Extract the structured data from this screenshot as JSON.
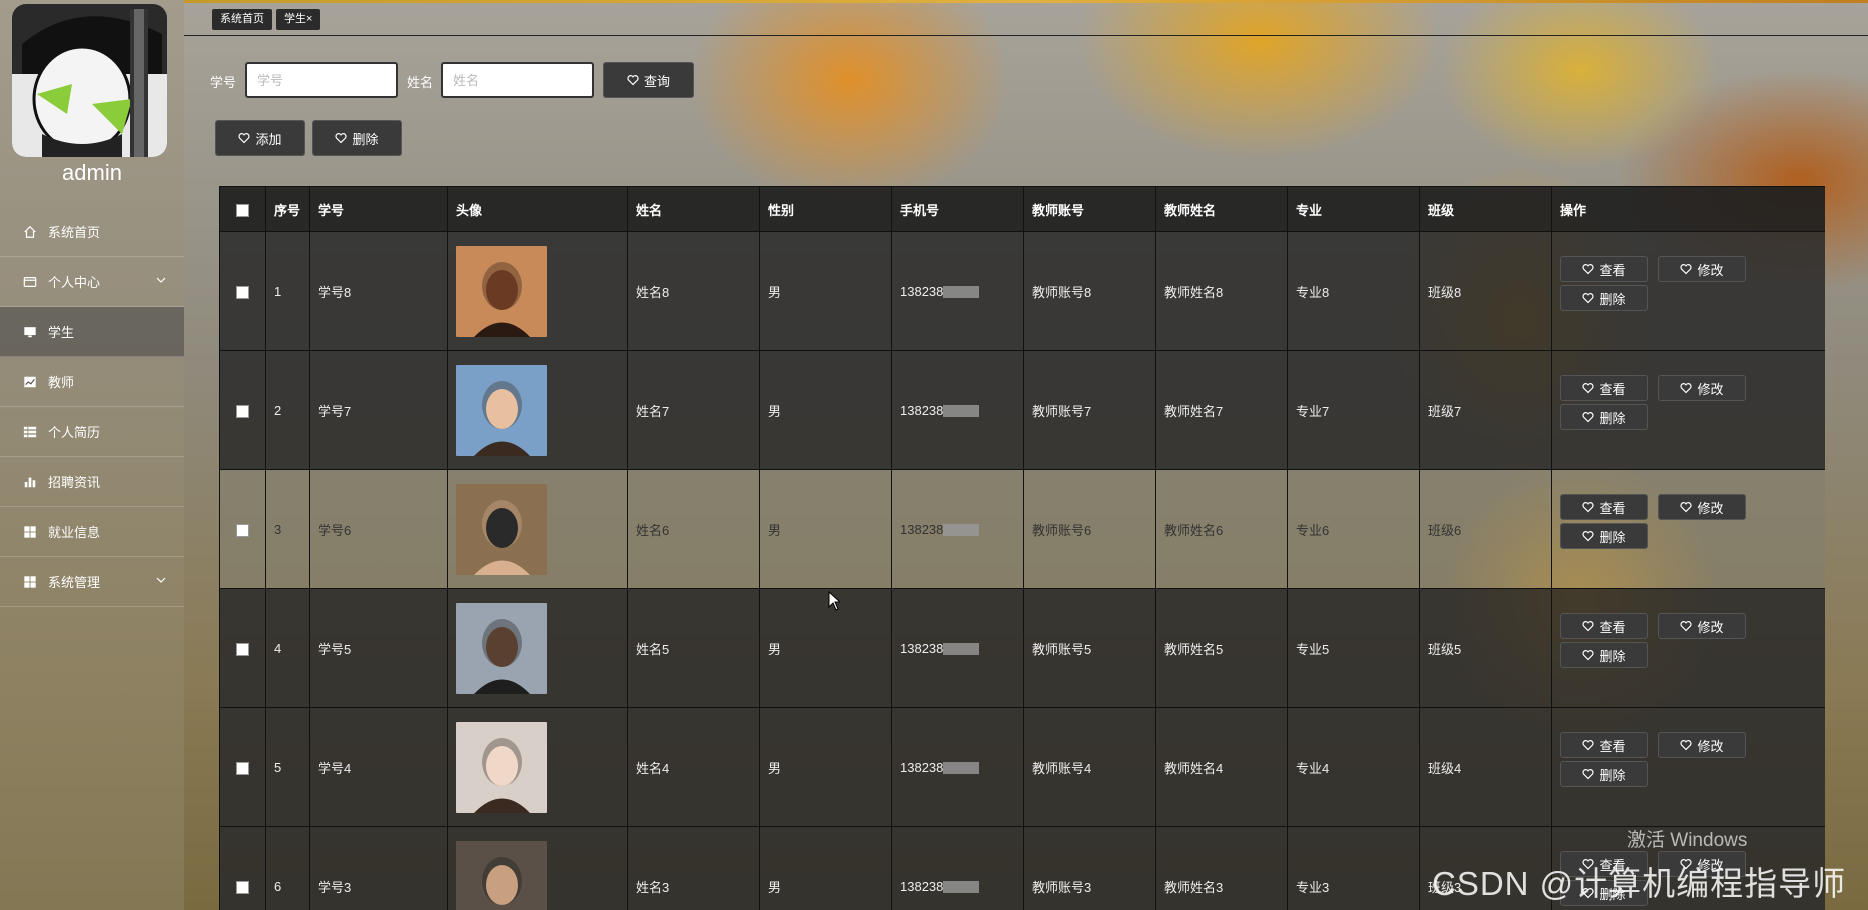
{
  "sidebar": {
    "username": "admin",
    "items": [
      {
        "label": "系统首页",
        "icon": "home-icon"
      },
      {
        "label": "个人中心",
        "icon": "id-card-icon",
        "expandable": true
      },
      {
        "label": "学生",
        "icon": "monitor-icon",
        "active": true
      },
      {
        "label": "教师",
        "icon": "chart-icon"
      },
      {
        "label": "个人简历",
        "icon": "grid-list-icon"
      },
      {
        "label": "招聘资讯",
        "icon": "bar-chart-icon"
      },
      {
        "label": "就业信息",
        "icon": "dashboard-icon"
      },
      {
        "label": "系统管理",
        "icon": "dashboard-icon",
        "expandable": true
      }
    ]
  },
  "tabs": {
    "home": "系统首页",
    "student": "学生"
  },
  "search": {
    "id_label": "学号",
    "id_placeholder": "学号",
    "name_label": "姓名",
    "name_placeholder": "姓名",
    "query_button": "查询"
  },
  "actions": {
    "add": "添加",
    "delete": "删除"
  },
  "table": {
    "headers": [
      "序号",
      "学号",
      "头像",
      "姓名",
      "性别",
      "手机号",
      "教师账号",
      "教师姓名",
      "专业",
      "班级",
      "操作"
    ],
    "ops": {
      "view": "查看",
      "edit": "修改",
      "delete": "删除"
    },
    "rows": [
      {
        "idx": "1",
        "sid": "学号8",
        "name": "姓名8",
        "gender": "男",
        "phone": "138238",
        "teacher_acct": "教师账号8",
        "teacher_name": "教师姓名8",
        "major": "专业8",
        "cls": "班级8"
      },
      {
        "idx": "2",
        "sid": "学号7",
        "name": "姓名7",
        "gender": "男",
        "phone": "138238",
        "teacher_acct": "教师账号7",
        "teacher_name": "教师姓名7",
        "major": "专业7",
        "cls": "班级7"
      },
      {
        "idx": "3",
        "sid": "学号6",
        "name": "姓名6",
        "gender": "男",
        "phone": "138238",
        "teacher_acct": "教师账号6",
        "teacher_name": "教师姓名6",
        "major": "专业6",
        "cls": "班级6"
      },
      {
        "idx": "4",
        "sid": "学号5",
        "name": "姓名5",
        "gender": "男",
        "phone": "138238",
        "teacher_acct": "教师账号5",
        "teacher_name": "教师姓名5",
        "major": "专业5",
        "cls": "班级5"
      },
      {
        "idx": "5",
        "sid": "学号4",
        "name": "姓名4",
        "gender": "男",
        "phone": "138238",
        "teacher_acct": "教师账号4",
        "teacher_name": "教师姓名4",
        "major": "专业4",
        "cls": "班级4"
      },
      {
        "idx": "6",
        "sid": "学号3",
        "name": "姓名3",
        "gender": "男",
        "phone": "138238",
        "teacher_acct": "教师账号3",
        "teacher_name": "教师姓名3",
        "major": "专业3",
        "cls": "班级3"
      }
    ]
  },
  "watermark": {
    "windows": "激活 Windows",
    "csdn": "CSDN @计算机编程指导师"
  }
}
